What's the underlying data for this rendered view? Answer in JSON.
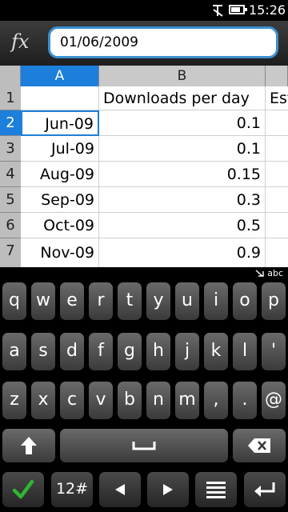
{
  "status": {
    "time": "15:26",
    "battery_level": 0.8
  },
  "formula_bar": {
    "fx_label": "fx",
    "value": "01/06/2009"
  },
  "sheet": {
    "columns": [
      "A",
      "B",
      "Est"
    ],
    "rows": [
      {
        "num": "1",
        "a": "",
        "b": "Downloads per day"
      },
      {
        "num": "2",
        "a": "Jun-09",
        "b": "0.1"
      },
      {
        "num": "3",
        "a": "Jul-09",
        "b": "0.1"
      },
      {
        "num": "4",
        "a": "Aug-09",
        "b": "0.15"
      },
      {
        "num": "5",
        "a": "Sep-09",
        "b": "0.3"
      },
      {
        "num": "6",
        "a": "Oct-09",
        "b": "0.5"
      },
      {
        "num": "7",
        "a": "Nov-09",
        "b": "0.9"
      }
    ]
  },
  "keyboard": {
    "mode": "abc",
    "row1": [
      "q",
      "w",
      "e",
      "r",
      "t",
      "y",
      "u",
      "i",
      "o",
      "p"
    ],
    "row2": [
      "a",
      "s",
      "d",
      "f",
      "g",
      "h",
      "j",
      "k",
      "l",
      "'"
    ],
    "row3": [
      "z",
      "x",
      "c",
      "v",
      "b",
      "n",
      "m",
      ",",
      ".",
      "@"
    ],
    "numsym_label": "12#",
    "icons": {
      "shift": "shift-icon",
      "space": "space-icon",
      "backspace": "backspace-icon",
      "ok": "checkmark-icon",
      "left": "left-arrow-icon",
      "right": "right-arrow-icon",
      "menu": "menu-icon",
      "enter": "enter-icon"
    },
    "colors": {
      "ok": "#2db534"
    }
  }
}
